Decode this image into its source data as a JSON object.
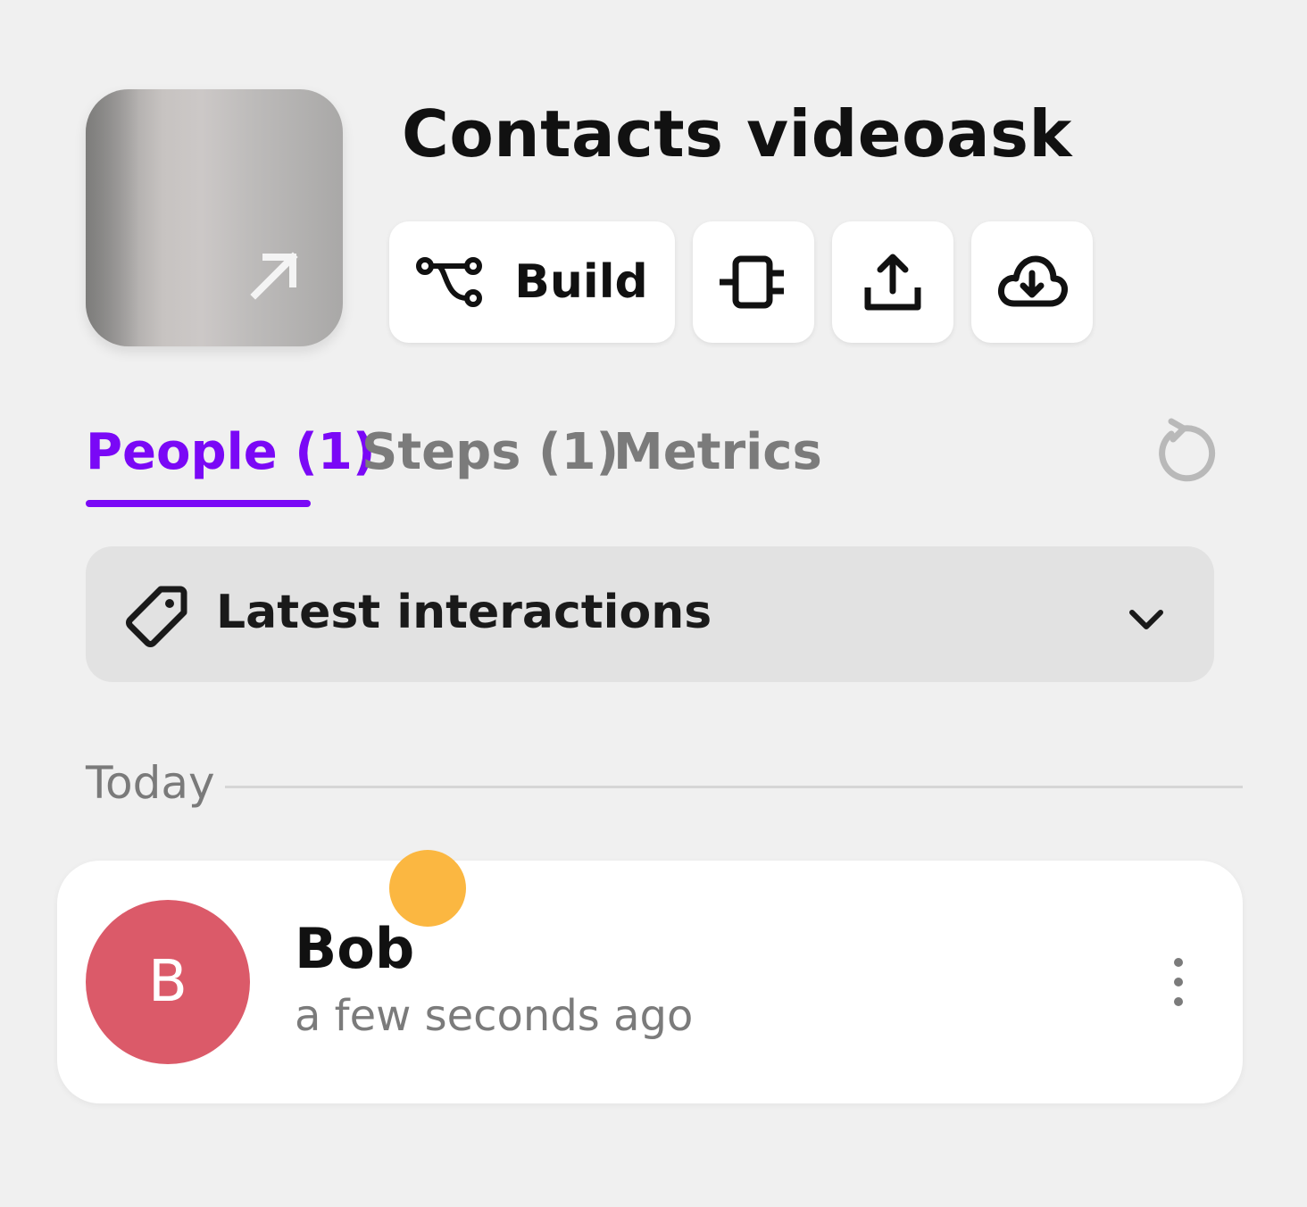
{
  "header": {
    "title": "Contacts videoask",
    "thumbnail_icon": "expand-arrow-icon"
  },
  "toolbar": {
    "build_label": "Build",
    "build_icon": "flow-icon",
    "integrations_icon": "plug-icon",
    "share_icon": "share-icon",
    "download_icon": "cloud-download-icon"
  },
  "tabs": [
    {
      "label": "People (1)",
      "active": true
    },
    {
      "label": "Steps (1)",
      "active": false
    },
    {
      "label": "Metrics",
      "active": false
    }
  ],
  "refresh_icon": "refresh-icon",
  "filter": {
    "label": "Latest interactions",
    "icon": "tag-icon",
    "chevron": "chevron-down-icon"
  },
  "separator": {
    "label": "Today"
  },
  "contacts": [
    {
      "initial": "B",
      "name": "Bob",
      "time": "a few seconds ago",
      "avatar_color": "#db5a69",
      "unread_dot_color": "#fbb741"
    }
  ],
  "colors": {
    "accent": "#7a08f6",
    "background": "#f0f0f0",
    "muted_text": "#7b7b7b"
  }
}
